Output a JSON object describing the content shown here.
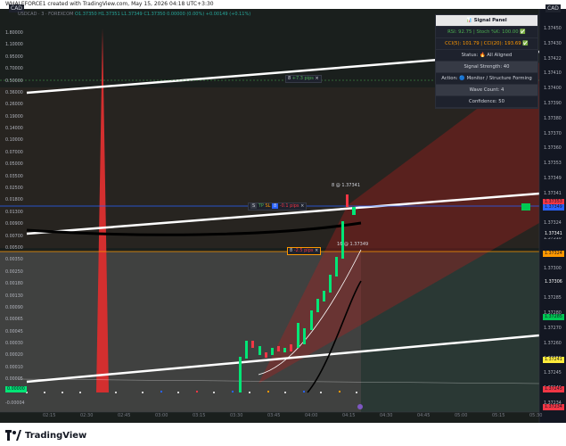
{
  "header": {
    "title": "WHALEFORCE1 created with TradingView.com, May 15, 2026 04:18 UTC+3:30"
  },
  "footer": {
    "brand": "TradingView"
  },
  "chart": {
    "currency_left": "CAD",
    "currency_right": "CAD",
    "legend": {
      "symbol": "USDCAD · 3 · FOREXCOM",
      "open": "O1.37350",
      "high": "H1.37351",
      "low": "L1.37349",
      "close": "C1.37350",
      "change": "0.00000 (0.00%)",
      "volume": "+0.00149 (+0.11%)"
    },
    "left_axis_labels": [
      "1.80000",
      "1.10000",
      "0.95000",
      "0.70000",
      "0.50000",
      "0.36000",
      "0.26000",
      "0.19000",
      "0.14000",
      "0.10000",
      "0.07000",
      "0.05000",
      "0.03500",
      "0.02500",
      "0.01800",
      "0.01300",
      "0.00900",
      "0.00700",
      "0.00500",
      "0.00350",
      "0.00250",
      "0.00180",
      "0.00130",
      "0.00090",
      "0.00065",
      "0.00045",
      "0.00030",
      "0.00020",
      "0.00010",
      "0.00005",
      "0.00000",
      "-0.00004"
    ],
    "right_axis_labels": [
      "1.37450",
      "1.37430",
      "1.37422",
      "1.37410",
      "1.37400",
      "1.37390",
      "1.37380",
      "1.37370",
      "1.37360",
      "1.37353",
      "1.37349",
      "1.37341",
      "1.37330",
      "1.37324",
      "1.37310",
      "1.37306",
      "1.37300",
      "1.37290",
      "1.37285",
      "1.37280",
      "1.37270",
      "1.37260",
      "1.37250",
      "1.37245",
      "1.37241",
      "1.37234"
    ],
    "x_axis_labels": [
      "02:15",
      "02:30",
      "02:45",
      "03:00",
      "03:15",
      "03:30",
      "03:45",
      "04:00",
      "04:15",
      "04:30",
      "04:45",
      "05:00",
      "05:15",
      "05:30"
    ],
    "price_tags": [
      {
        "label": "1.37353",
        "color": "#f23645"
      },
      {
        "label": "1.37349",
        "color": "#2962ff"
      },
      {
        "label": "1.37341",
        "color": "#131722"
      },
      {
        "label": "1.37324",
        "color": "#ff9800"
      },
      {
        "label": "1.37306",
        "color": "#131722"
      },
      {
        "label": "1.37285",
        "color": "#00c853"
      },
      {
        "label": "1.37241",
        "color": "#ffeb3b"
      },
      {
        "label": "1.37245",
        "color": "#f23645"
      },
      {
        "label": "1.37234",
        "color": "#f23645"
      }
    ],
    "left_axis_tag": "0.00000",
    "annotations": {
      "top_pill_num": "8",
      "top_pill_text": "+7.3 pips",
      "mid_pill_s": "S",
      "mid_pill_tp": "TP",
      "mid_pill_sl": "SL",
      "mid_pill_num": "8",
      "mid_pill_text": "-0.1 pips",
      "low_pill_num": "8",
      "low_pill_text": "-2.5 pips",
      "close_x": "×",
      "top_note": "8 @ 1.37341",
      "low_note": "16 @ 1.37349"
    }
  },
  "signal_panel": {
    "title": "📊 Signal Panel",
    "rsi": "RSI: 92.75 | Stoch %K: 100.00 ✅",
    "cci": "CCI(5): 101.79 | CCI(20): 193.69 ✅",
    "status": "Status: 🔥 All Aligned",
    "strength": "Signal Strength: 40",
    "action": "Action: 🔵 Monitor / Structure Forming",
    "wave": "Wave Count: 4",
    "confidence": "Confidence: 50"
  },
  "colors": {
    "bg": "#131722",
    "bull": "#00e676",
    "bear": "#f23645",
    "accent": "#2962ff"
  }
}
